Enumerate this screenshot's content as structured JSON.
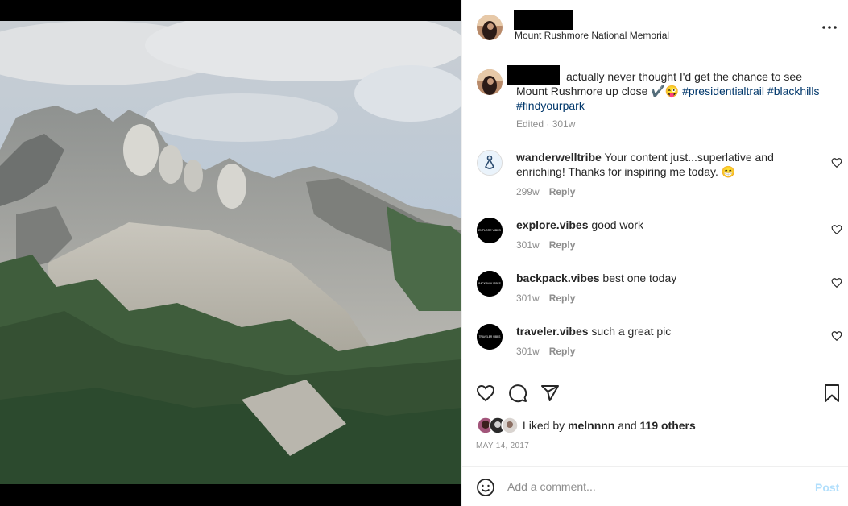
{
  "post": {
    "location": "Mount Rushmore National Memorial",
    "more_icon": "more-horizontal-icon"
  },
  "caption": {
    "text_line": "actually never thought I'd get the chance to see Mount Rushmore up close ✔️😜 ",
    "tag1": "#presidentialtrail",
    "tag2": "#blackhills",
    "tag3": "#findyourpark",
    "meta": "Edited · 301w"
  },
  "comments": [
    {
      "user": "wanderwelltribe",
      "text": "Your content just...superlative and enriching! Thanks for inspiring me today. 😁",
      "age": "299w",
      "reply": "Reply"
    },
    {
      "user": "explore.vibes",
      "text": "good work",
      "age": "301w",
      "reply": "Reply"
    },
    {
      "user": "backpack.vibes",
      "text": "best one today",
      "age": "301w",
      "reply": "Reply"
    },
    {
      "user": "traveler.vibes",
      "text": "such a great pic",
      "age": "301w",
      "reply": "Reply"
    }
  ],
  "likes": {
    "prefix": "Liked by",
    "user": "melnnnn",
    "and": "and",
    "others": "119 others"
  },
  "date": "MAY 14, 2017",
  "add_comment": {
    "placeholder": "Add a comment...",
    "post_label": "Post"
  },
  "avatar_logo_texts": {
    "explore": "EXPLORE VIBES",
    "backpack": "BACKPACK VIBES",
    "traveler": "TRAVELER VIBES"
  },
  "colors": {
    "link": "#00376b",
    "muted": "#8e8e8e",
    "post_disabled": "#b2dffc"
  }
}
